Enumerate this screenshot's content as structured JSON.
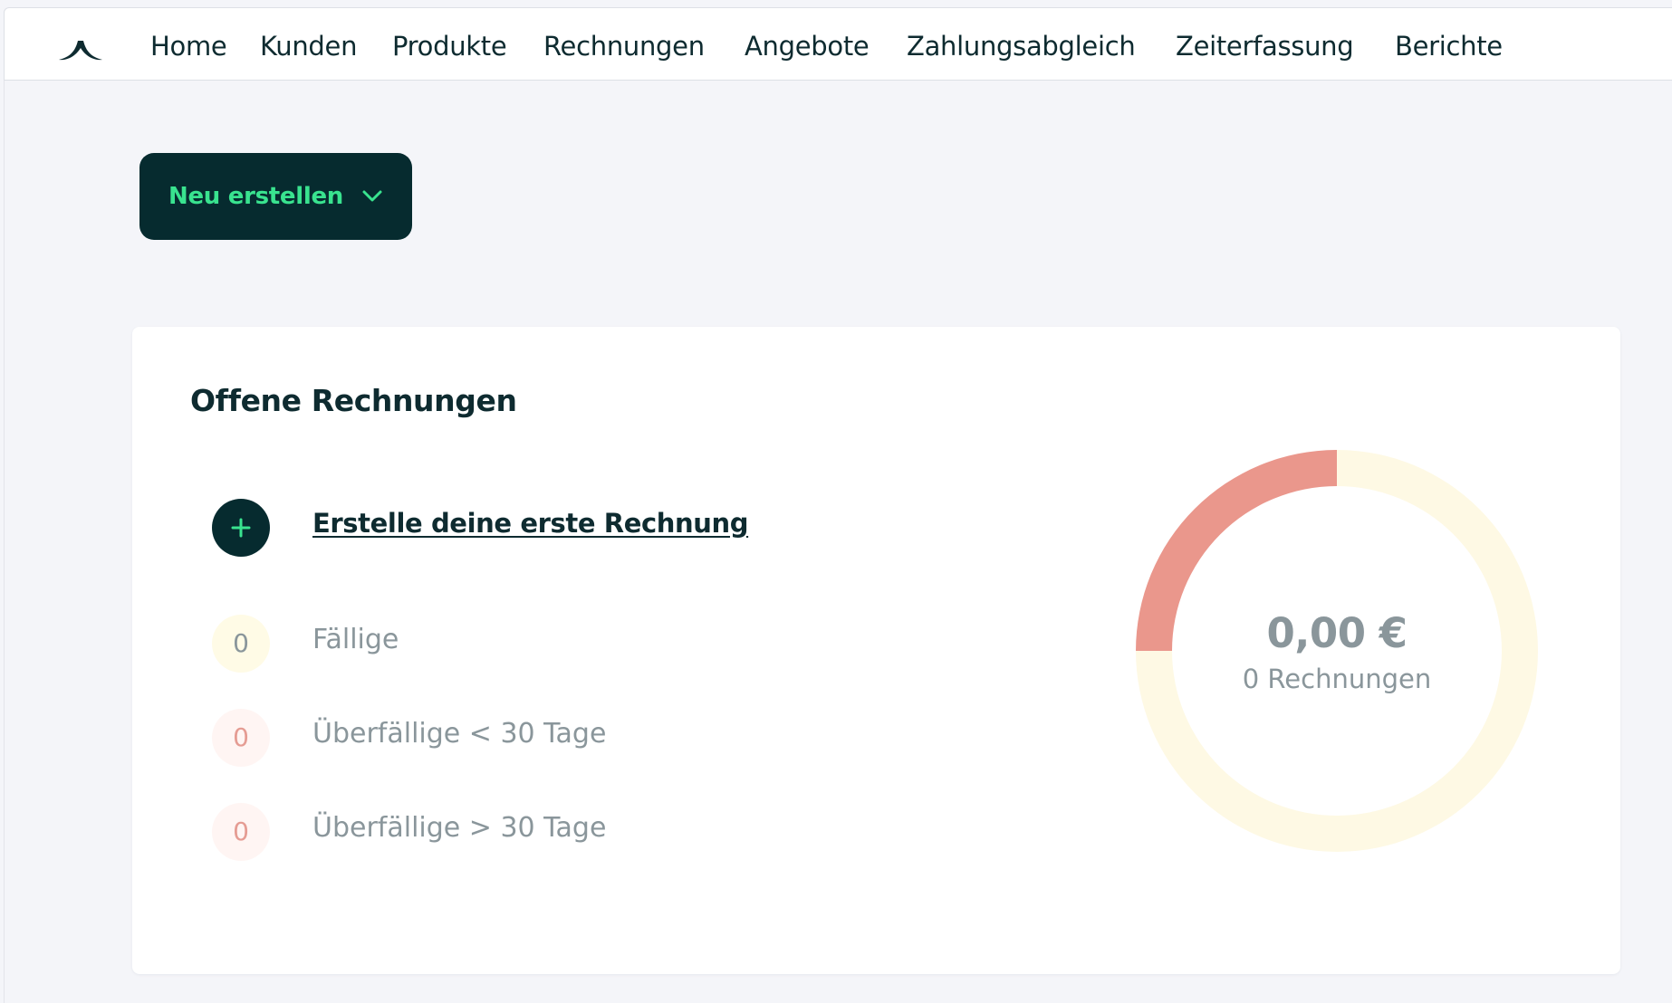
{
  "nav": {
    "items": [
      {
        "label": "Home"
      },
      {
        "label": "Kunden"
      },
      {
        "label": "Produkte"
      },
      {
        "label": "Rechnungen"
      },
      {
        "label": "Angebote"
      },
      {
        "label": "Zahlungsabgleich"
      },
      {
        "label": "Zeiterfassung"
      },
      {
        "label": "Berichte"
      }
    ]
  },
  "toolbar": {
    "new_button_label": "Neu erstellen",
    "new_button_icon": "chevron-down-icon"
  },
  "open_invoices": {
    "title": "Offene Rechnungen",
    "create_link_label": "Erstelle deine erste Rechnung",
    "create_icon": "plus-icon",
    "statuses": [
      {
        "count": "0",
        "label": "Fällige",
        "color": "#fffbe6"
      },
      {
        "count": "0",
        "label": "Überfällige < 30 Tage",
        "color": "#fff5f3"
      },
      {
        "count": "0",
        "label": "Überfällige > 30 Tage",
        "color": "#fff5f3"
      }
    ],
    "summary": {
      "amount": "0,00 €",
      "invoice_count": "0 Rechnungen"
    },
    "donut": {
      "segments": [
        {
          "fraction": 0.75,
          "color": "#fef9e4"
        },
        {
          "fraction": 0.25,
          "color": "#ea978c"
        }
      ]
    }
  },
  "colors": {
    "brand_dark": "#062b2f",
    "accent_green": "#39e38f",
    "text_primary": "#0e2b30",
    "text_muted": "#8a969b",
    "background": "#f4f5f9"
  }
}
